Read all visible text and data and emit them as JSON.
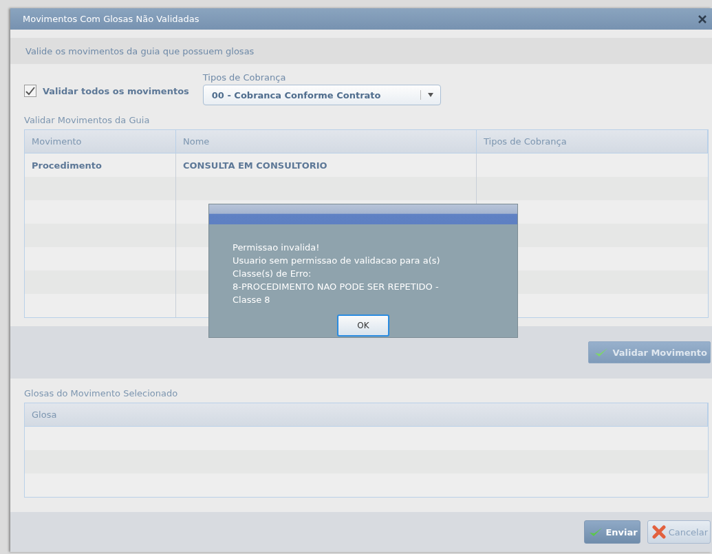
{
  "dialog": {
    "title": "Movimentos Com Glosas Não Validadas",
    "subtitle": "Valide os movimentos da guia que possuem glosas"
  },
  "validate_all": {
    "label": "Validar todos os movimentos",
    "checked": true
  },
  "billing_type": {
    "label": "Tipos de Cobrança",
    "value": "00 - Cobranca Conforme Contrato"
  },
  "movements": {
    "title": "Validar Movimentos da Guia",
    "columns": [
      "Movimento",
      "Nome",
      "Tipos de Cobrança"
    ],
    "rows": [
      {
        "cells": [
          "Procedimento",
          "CONSULTA EM CONSULTORIO",
          ""
        ]
      }
    ],
    "validate_button": "Validar Movimento"
  },
  "glosas": {
    "title": "Glosas do Movimento Selecionado",
    "columns": [
      "Glosa"
    ]
  },
  "footer_buttons": [
    {
      "label": "Enviar",
      "kind": "confirm"
    },
    {
      "label": "Cancelar",
      "kind": "cancel"
    }
  ],
  "alert": {
    "lines": [
      "Permissao invalida!",
      "Usuario sem permissao de validacao para a(s)",
      "Classe(s) de Erro:",
      "8-PROCEDIMENTO NAO PODE SER REPETIDO -",
      "Classe 8"
    ],
    "button": "OK"
  }
}
